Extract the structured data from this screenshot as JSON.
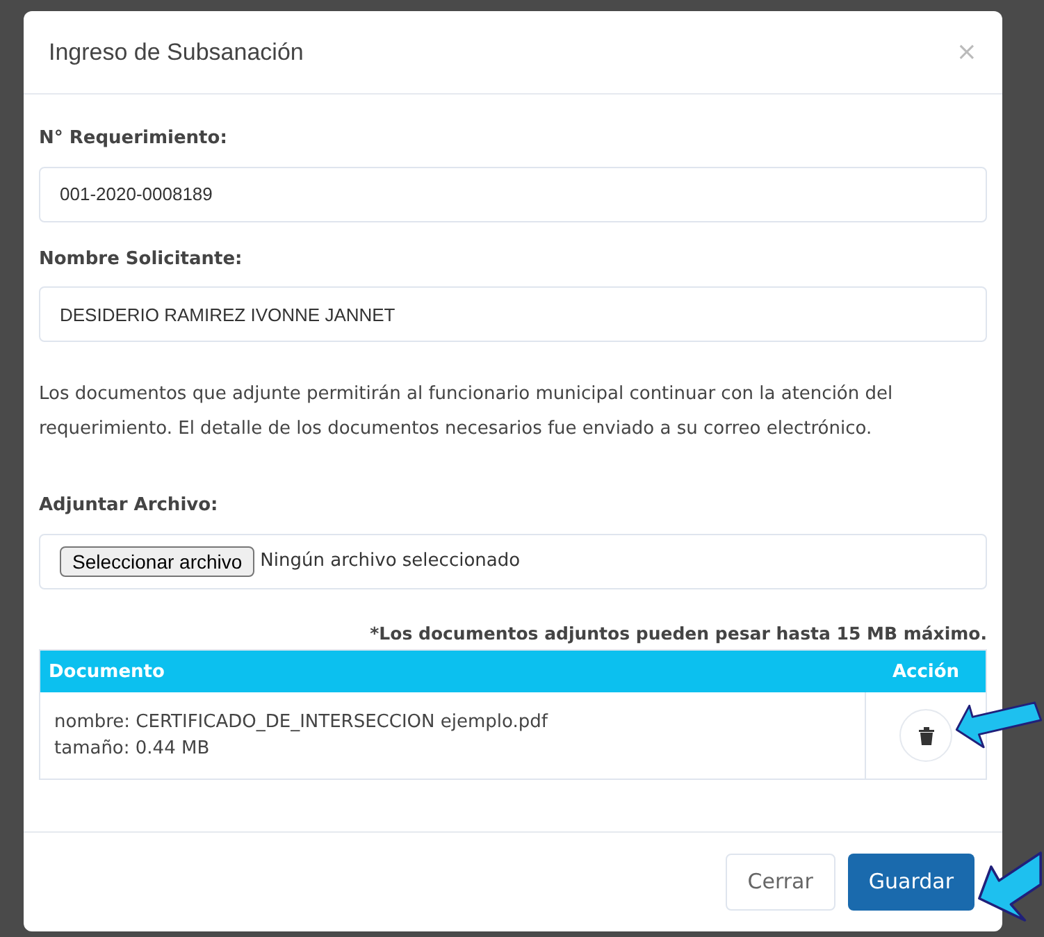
{
  "modal": {
    "title": "Ingreso de Subsanación",
    "close": "×"
  },
  "fields": [
    {
      "label": "N° Requerimiento:",
      "value": "001-2020-0008189"
    },
    {
      "label": "Nombre Solicitante:",
      "value": "DESIDERIO RAMIREZ IVONNE JANNET"
    }
  ],
  "notice": "Los documentos que adjunte permitirán al funcionario municipal continuar con la atención del requerimiento. El detalle de los documentos necesarios fue enviado a su correo electrónico.",
  "attach": {
    "label": "Adjuntar Archivo:",
    "button": "Seleccionar archivo",
    "status": "Ningún archivo seleccionado"
  },
  "limit_note": "*Los documentos adjuntos pueden pesar hasta 15 MB máximo.",
  "table": {
    "columns": [
      "Documento",
      "Acción"
    ],
    "rows": [
      {
        "name": "nombre: CERTIFICADO_DE_INTERSECCION ejemplo.pdf",
        "size": "tamaño: 0.44 MB"
      }
    ]
  },
  "buttons": [
    {
      "label": "Cerrar",
      "kind": "secondary"
    },
    {
      "label": "Guardar",
      "kind": "primary"
    }
  ]
}
